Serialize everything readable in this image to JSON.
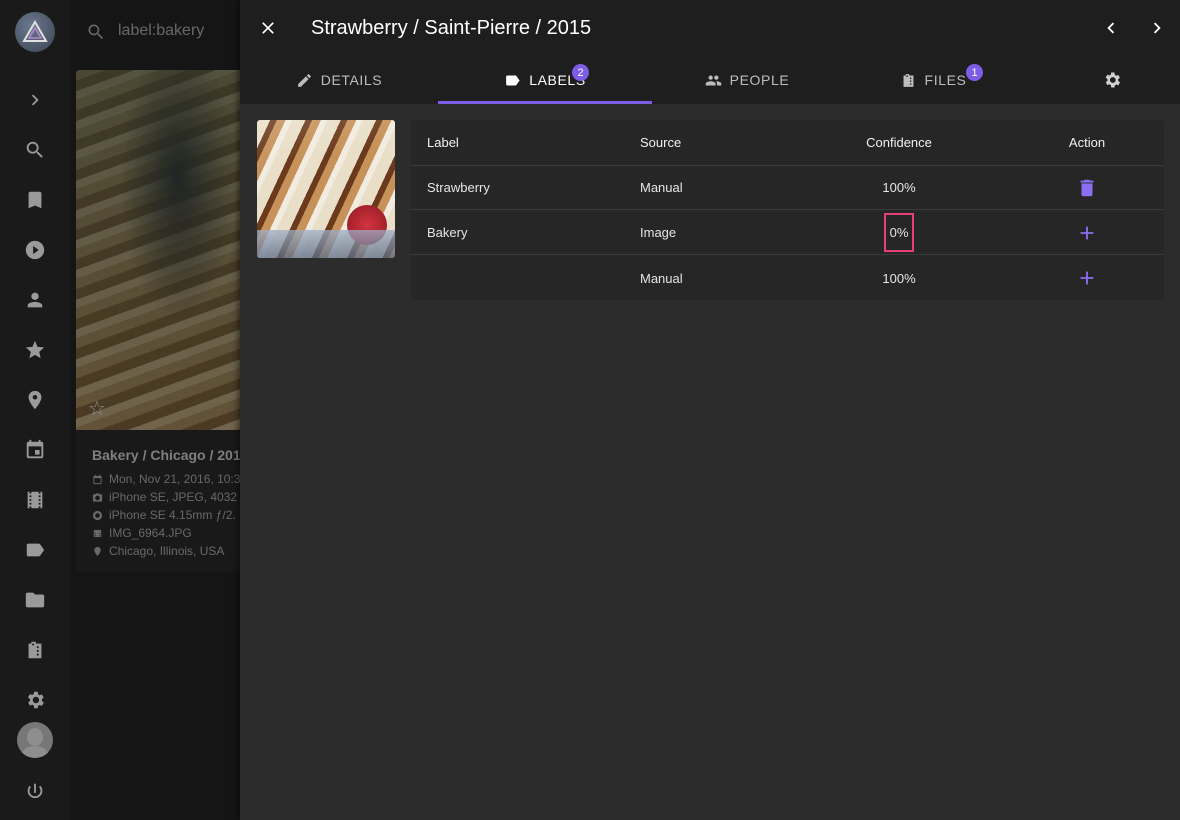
{
  "background": {
    "search_text": "label:bakery",
    "card": {
      "title": "Bakery / Chicago / 201",
      "date": "Mon, Nov 21, 2016, 10:3",
      "camera": "iPhone SE, JPEG, 4032",
      "lens": "iPhone SE 4.15mm ƒ/2.",
      "file": "IMG_6964.JPG",
      "location": "Chicago, Illinois, USA"
    }
  },
  "dialog": {
    "title": "Strawberry / Saint-Pierre / 2015",
    "tabs": [
      {
        "label": "DETAILS",
        "badge": ""
      },
      {
        "label": "LABELS",
        "badge": "2"
      },
      {
        "label": "PEOPLE",
        "badge": ""
      },
      {
        "label": "FILES",
        "badge": "1"
      }
    ],
    "table": {
      "headers": [
        "Label",
        "Source",
        "Confidence",
        "Action"
      ],
      "rows": [
        {
          "label": "Strawberry",
          "source": "Manual",
          "confidence": "100%",
          "action": "delete-icon"
        },
        {
          "label": "Bakery",
          "source": "Image",
          "confidence": "0%",
          "action": "add-icon"
        },
        {
          "label": "",
          "source": "Manual",
          "confidence": "100%",
          "action": "add-icon"
        }
      ]
    }
  },
  "colors": {
    "accent": "#7d5ce6",
    "highlight": "#e83e76"
  }
}
